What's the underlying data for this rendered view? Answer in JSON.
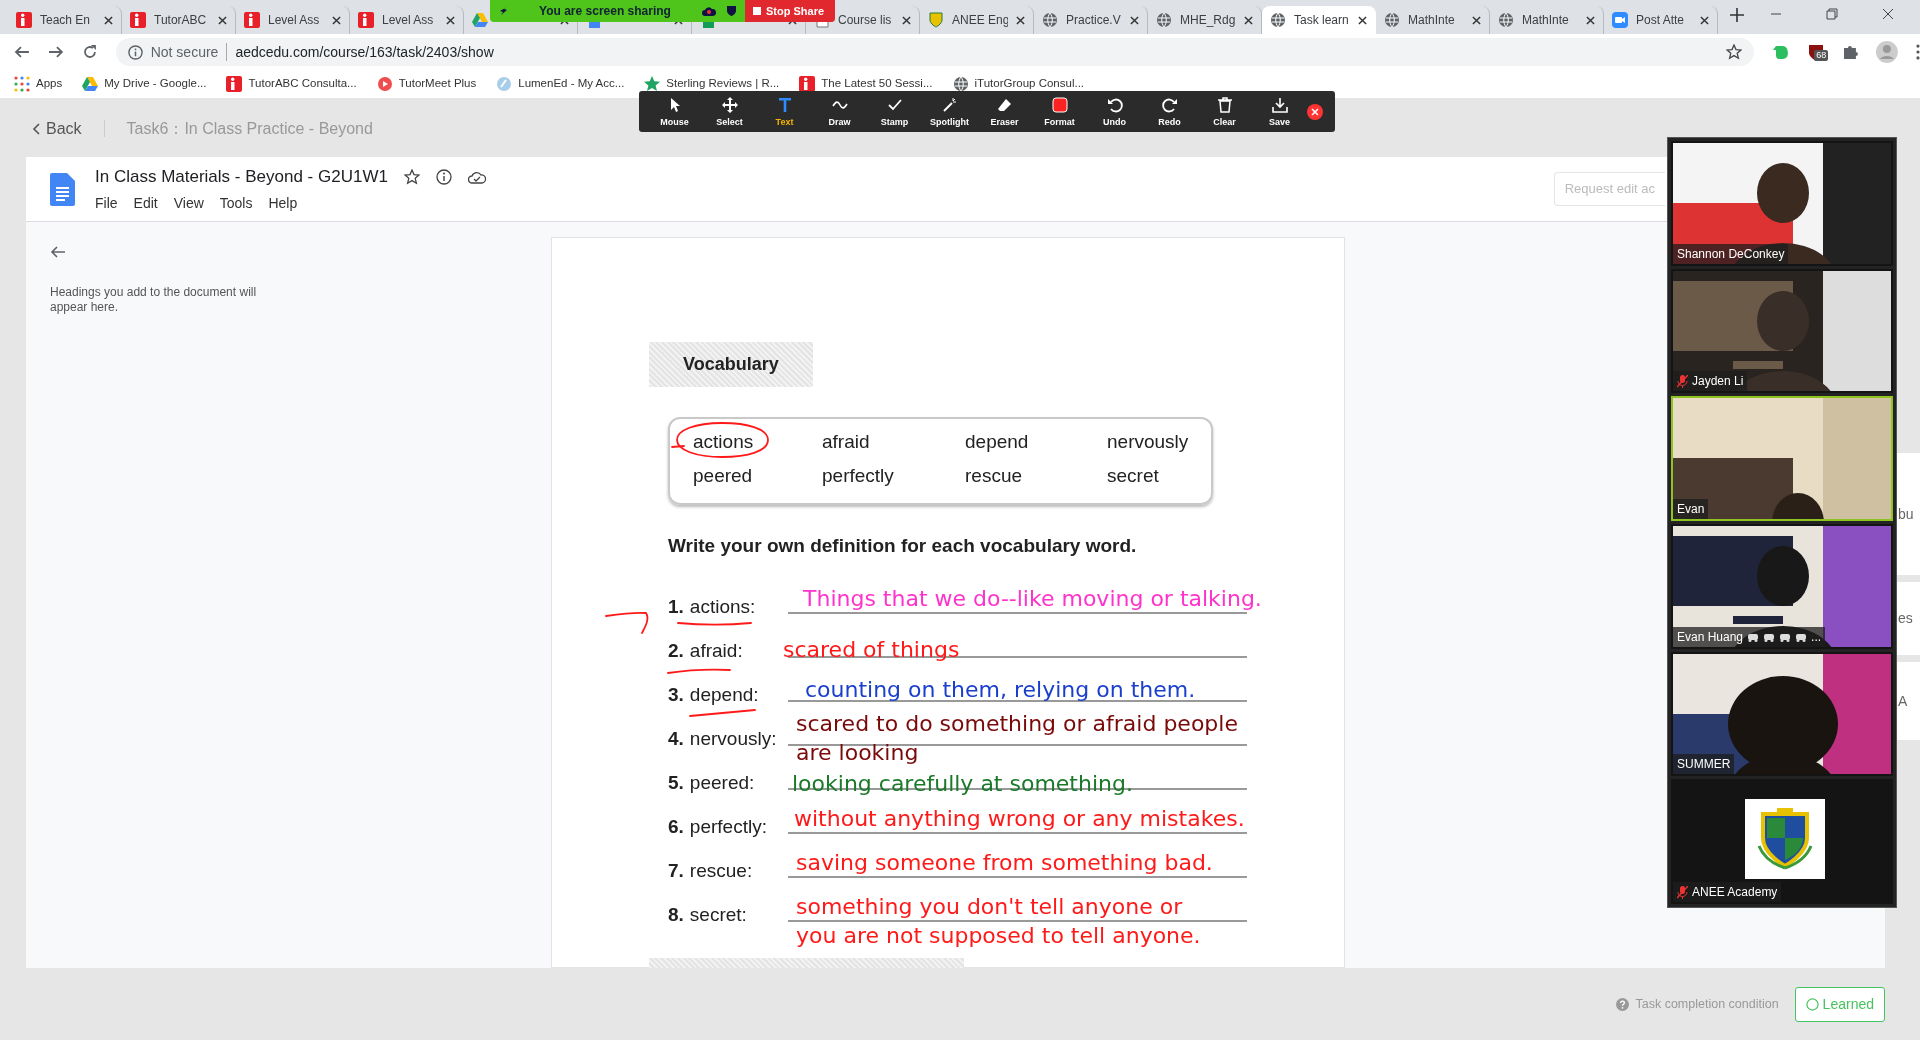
{
  "browser": {
    "tabs": [
      {
        "label": "Teach En",
        "kind": "itutor",
        "selected": false
      },
      {
        "label": "TutorABC",
        "kind": "itutor",
        "selected": false
      },
      {
        "label": "Level Ass",
        "kind": "itutor",
        "selected": false
      },
      {
        "label": "Level Ass",
        "kind": "itutor",
        "selected": false
      },
      {
        "kind": "drive",
        "selected": false
      },
      {
        "kind": "docs",
        "selected": false
      },
      {
        "kind": "sheets",
        "selected": false
      },
      {
        "label": "Course lis",
        "kind": "page",
        "selected": false
      },
      {
        "label": "ANEE Eng",
        "kind": "anee",
        "selected": false
      },
      {
        "label": "Practice.V",
        "kind": "globe",
        "selected": false
      },
      {
        "label": "MHE_Rdg",
        "kind": "globe",
        "selected": false
      },
      {
        "label": "Task learn",
        "kind": "globe",
        "selected": true
      },
      {
        "label": "MathInte",
        "kind": "globe",
        "selected": false
      },
      {
        "label": "MathInte",
        "kind": "globe",
        "selected": false
      },
      {
        "label": "Post Atte",
        "kind": "zoom",
        "selected": false
      }
    ],
    "share_banner": {
      "status": "You are screen sharing",
      "stop": "Stop Share"
    },
    "address": {
      "security": "Not secure",
      "url": "aedcedu.com/course/163/task/2403/show"
    },
    "extension_badge": "68",
    "bookmarks": [
      {
        "label": "Apps",
        "kind": "apps"
      },
      {
        "label": "My Drive - Google...",
        "kind": "drive"
      },
      {
        "label": "TutorABC Consulta...",
        "kind": "itutor"
      },
      {
        "label": "TutorMeet Plus",
        "kind": "meet"
      },
      {
        "label": "LumenEd - My Acc...",
        "kind": "lumen"
      },
      {
        "label": "Sterling Reviews | R...",
        "kind": "star"
      },
      {
        "label": "The Latest 50 Sessi...",
        "kind": "itutor"
      },
      {
        "label": "iTutorGroup Consul...",
        "kind": "globe"
      }
    ]
  },
  "annotation_toolbar": {
    "tools": [
      {
        "label": "Mouse",
        "kind": "mouse",
        "selected": false
      },
      {
        "label": "Select",
        "kind": "select",
        "selected": false
      },
      {
        "label": "Text",
        "kind": "text",
        "selected": true
      },
      {
        "label": "Draw",
        "kind": "draw",
        "selected": false
      },
      {
        "label": "Stamp",
        "kind": "stamp",
        "selected": false
      },
      {
        "label": "Spotlight",
        "kind": "spotlight",
        "selected": false
      },
      {
        "label": "Eraser",
        "kind": "eraser",
        "selected": false
      },
      {
        "label": "Format",
        "kind": "format",
        "selected": false
      },
      {
        "label": "Undo",
        "kind": "undo",
        "selected": false
      },
      {
        "label": "Redo",
        "kind": "redo",
        "selected": false
      },
      {
        "label": "Clear",
        "kind": "clear",
        "selected": false
      },
      {
        "label": "Save",
        "kind": "save",
        "selected": false
      }
    ]
  },
  "page": {
    "back": "Back",
    "task_title": "Task6：In Class Practice - Beyond"
  },
  "document": {
    "title": "In Class Materials - Beyond - G2U1W1",
    "menu": [
      "File",
      "Edit",
      "View",
      "Tools",
      "Help"
    ],
    "request_edit": "Request edit ac",
    "outline_hint": "Headings you add to the document will appear here.",
    "worksheet": {
      "heading": "Vocabulary",
      "word_bank": [
        "actions",
        "afraid",
        "depend",
        "nervously",
        "peered",
        "perfectly",
        "rescue",
        "secret"
      ],
      "instruction": "Write your own definition for each vocabulary word.",
      "items": [
        {
          "number": "1.",
          "word": "actions:",
          "answer": [
            "Things that we do--like moving or talking."
          ],
          "color": "#ff33cc"
        },
        {
          "number": "2.",
          "word": "afraid:",
          "answer": [
            "scared of things"
          ],
          "color": "#ff1a1a"
        },
        {
          "number": "3.",
          "word": "depend:",
          "answer": [
            "counting on them, relying on them."
          ],
          "color": "#1a3fcc"
        },
        {
          "number": "4.",
          "word": "nervously:",
          "answer": [
            "scared to do something or afraid people",
            "are looking"
          ],
          "color": "#7a0a0a"
        },
        {
          "number": "5.",
          "word": "peered:",
          "answer": [
            "looking carefully at something."
          ],
          "color": "#1a7a2a"
        },
        {
          "number": "6.",
          "word": "perfectly:",
          "answer": [
            "without anything wrong or any mistakes."
          ],
          "color": "#ff1a1a"
        },
        {
          "number": "7.",
          "word": "rescue:",
          "answer": [
            "saving someone from something bad."
          ],
          "color": "#ff1a1a"
        },
        {
          "number": "8.",
          "word": "secret:",
          "answer": [
            "something you don't tell anyone or",
            "you are not supposed to tell anyone."
          ],
          "color": "#ff1a1a"
        }
      ]
    }
  },
  "video_panel": {
    "participants": [
      {
        "name": "Shannon DeConkey",
        "kind": "picture",
        "muted": false,
        "speaking": false
      },
      {
        "name": "Jayden Li",
        "kind": "picture",
        "muted": true,
        "speaking": false
      },
      {
        "name": "Evan",
        "kind": "picture",
        "muted": false,
        "speaking": true
      },
      {
        "name": "Evan Huang",
        "name_tail": "...",
        "kind": "picture",
        "muted": false,
        "speaking": false
      },
      {
        "name": "SUMMER",
        "kind": "picture",
        "muted": false,
        "speaking": false
      },
      {
        "name": "ANEE Academy",
        "kind": "logo",
        "muted": true,
        "speaking": false
      }
    ]
  },
  "side_fragments": [
    "bu",
    "es",
    "A"
  ],
  "footer": {
    "condition": "Task completion condition",
    "learned": "Learned"
  }
}
